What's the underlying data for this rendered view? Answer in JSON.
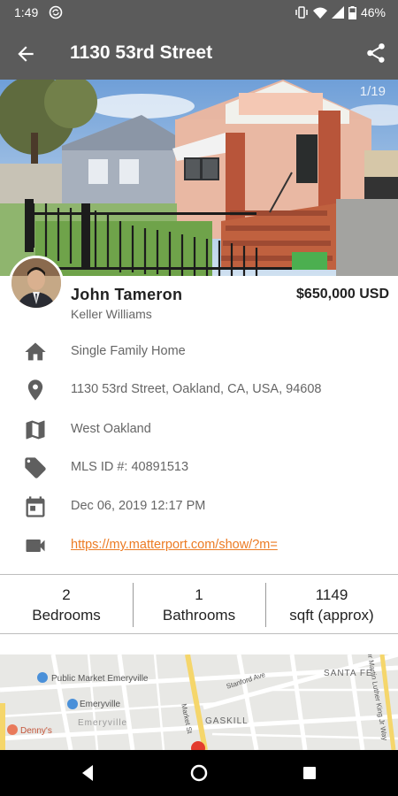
{
  "status_bar": {
    "time": "1:49",
    "battery": "46%"
  },
  "app_bar": {
    "title": "1130 53rd Street"
  },
  "gallery": {
    "counter": "1/19"
  },
  "agent": {
    "name": "John Tameron",
    "company": "Keller Williams"
  },
  "listing": {
    "price": "$650,000 USD"
  },
  "details": [
    {
      "icon": "home-icon",
      "text": "Single Family Home"
    },
    {
      "icon": "location-pin-icon",
      "text": "1130 53rd Street, Oakland, CA, USA, 94608"
    },
    {
      "icon": "map-icon",
      "text": "West Oakland"
    },
    {
      "icon": "tag-icon",
      "text": "MLS ID #: 40891513"
    },
    {
      "icon": "calendar-icon",
      "text": "Dec 06, 2019 12:17 PM"
    },
    {
      "icon": "video-camera-icon",
      "text": "https://my.matterport.com/show/?m="
    }
  ],
  "stats": [
    {
      "value": "2",
      "label": "Bedrooms"
    },
    {
      "value": "1",
      "label": "Bathrooms"
    },
    {
      "value": "1149",
      "label": "sqft (approx)"
    }
  ],
  "map": {
    "labels": {
      "public_market": "Public Market Emeryville",
      "emeryville_station": "Emeryville",
      "dennys": "Denny's",
      "emeryville": "Emeryville",
      "gaskill": "GASKILL",
      "santa_fe": "SANTA FE",
      "stanford_ave": "Stanford Ave",
      "market_st": "Market St",
      "mlk_way": "Dr Martin Luther King Jr Way"
    }
  },
  "colors": {
    "bar": "#5b5b5b",
    "link": "#ec7b23",
    "nav": "#000000"
  }
}
